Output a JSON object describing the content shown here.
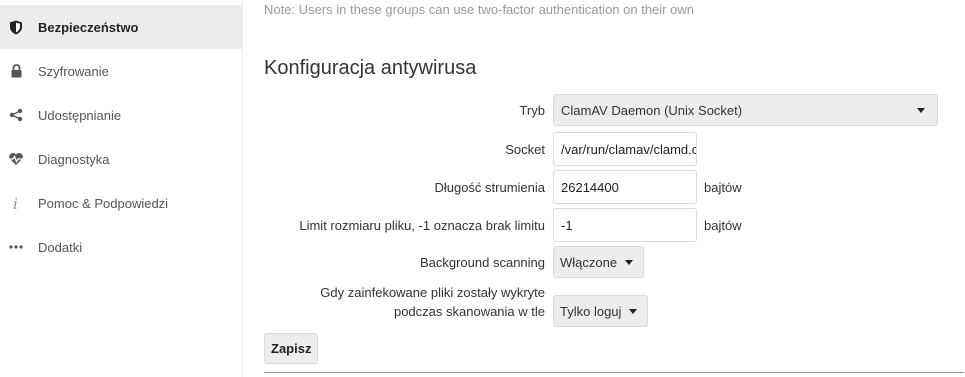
{
  "sidebar": {
    "items": [
      {
        "label": "Bezpieczeństwo",
        "icon": "shield-icon",
        "active": true
      },
      {
        "label": "Szyfrowanie",
        "icon": "lock-icon"
      },
      {
        "label": "Udostępnianie",
        "icon": "share-icon"
      },
      {
        "label": "Diagnostyka",
        "icon": "heartbeat-icon"
      },
      {
        "label": "Pomoc & Podpowiedzi",
        "icon": "info-icon"
      },
      {
        "label": "Dodatki",
        "icon": "more-icon"
      }
    ]
  },
  "main": {
    "note": "Note: Users in these groups can use two-factor authentication on their own",
    "section_title": "Konfiguracja antywirusa",
    "form": {
      "mode_label": "Tryb",
      "mode_value": "ClamAV Daemon (Unix Socket)",
      "socket_label": "Socket",
      "socket_value": "/var/run/clamav/clamd.ctl",
      "stream_label": "Długość strumienia",
      "stream_value": "26214400",
      "stream_unit": "bajtów",
      "filesize_label": "Limit rozmiaru pliku, -1 oznacza brak limitu",
      "filesize_value": "-1",
      "filesize_unit": "bajtów",
      "background_label": "Background scanning",
      "background_value": "Włączone",
      "infected_label_line1": "Gdy zainfekowane pliki zostały wykryte",
      "infected_label_line2": "podczas skanowania w tle",
      "infected_value": "Tylko loguj"
    },
    "save_label": "Zapisz"
  }
}
